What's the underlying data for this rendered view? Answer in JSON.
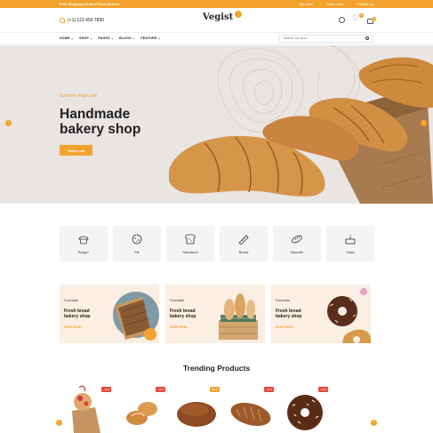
{
  "topbar": {
    "promo": "Free Shipping Orders From All Item",
    "links": [
      "My order",
      "Track order",
      "Contact us"
    ]
  },
  "header": {
    "phone": "(+1) 123 456 7890",
    "logo": "Vegist",
    "wishlist_count": "0",
    "cart_count": "0"
  },
  "nav": {
    "items": [
      "HOME",
      "SHOP",
      "PAGES",
      "BLOGS",
      "FEATURE"
    ],
    "search_placeholder": "Search our store"
  },
  "hero": {
    "eyebrow": "Summer Vege sale",
    "title": "Handmade bakery shop",
    "cta": "Shop now"
  },
  "categories": [
    "Burger",
    "Pie",
    "Sandwich",
    "Bread",
    "Biscuits",
    "Cake"
  ],
  "promos": [
    {
      "eyebrow": "Food taste",
      "title": "Fresh bread bakery shop",
      "link": "SHOP NOW"
    },
    {
      "eyebrow": "Food taste",
      "title": "Fresh bread bakery shop",
      "link": "SHOP NOW"
    },
    {
      "eyebrow": "Food taste",
      "title": "Fresh bread bakery shop",
      "link": "SHOP NOW"
    }
  ],
  "trending": {
    "title": "Trending Products",
    "badges": [
      "-11%",
      "-13%",
      "NEW",
      "-11%",
      "-13%"
    ]
  },
  "colors": {
    "accent": "#f2a32d",
    "sale": "#e84a3b",
    "hero_bg": "#e9e5e3",
    "promo_bg": "#fbeee2"
  }
}
